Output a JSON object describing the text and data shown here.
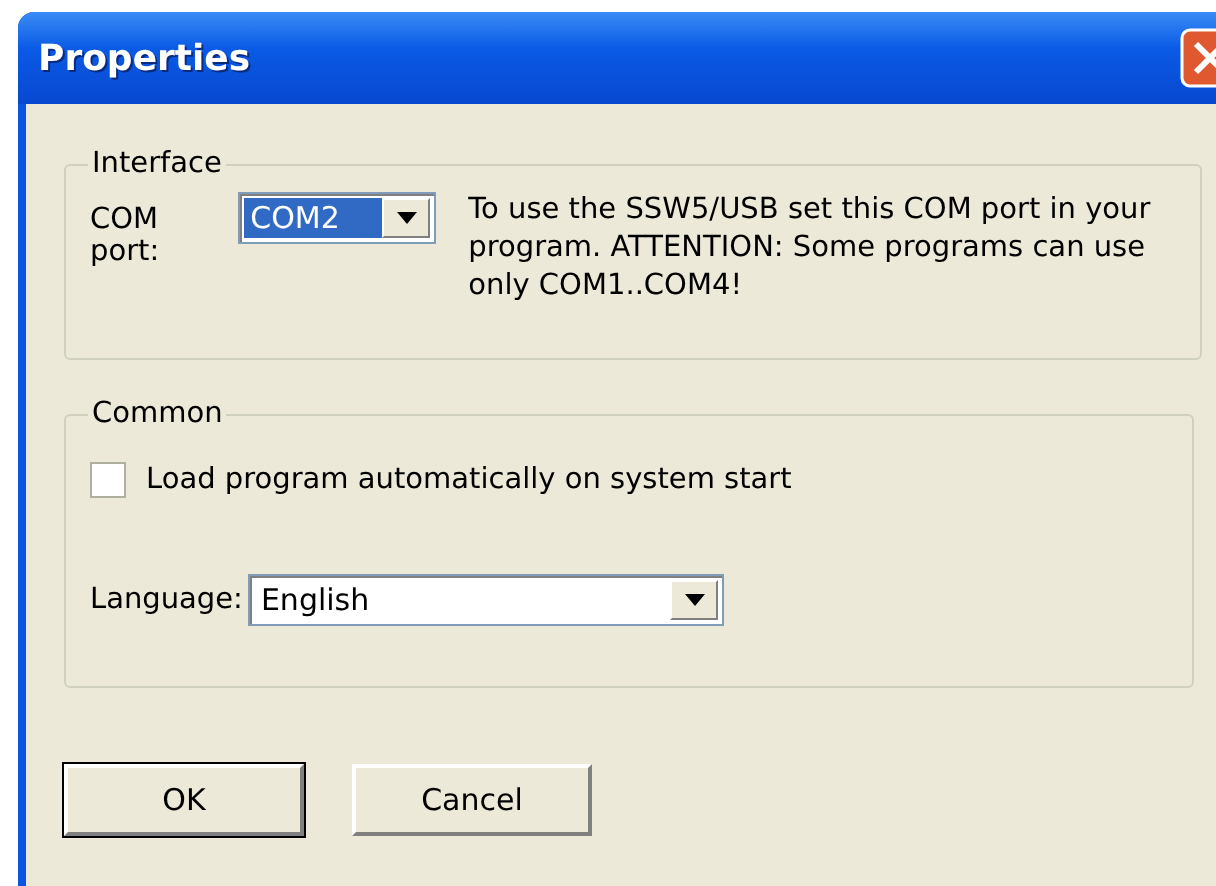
{
  "window": {
    "title": "Properties"
  },
  "interface": {
    "legend": "Interface",
    "com_port": {
      "label": "COM port:",
      "value": "COM2",
      "selected": true
    },
    "note": "To use the SSW5/USB set this COM port in your program. ATTENTION: Some programs can use only COM1..COM4!"
  },
  "common": {
    "legend": "Common",
    "autoload": {
      "label": "Load program automatically on system start",
      "checked": false
    },
    "language": {
      "label": "Language:",
      "value": "English"
    }
  },
  "buttons": [
    {
      "label": "OK",
      "default": true
    },
    {
      "label": "Cancel",
      "default": false
    }
  ]
}
